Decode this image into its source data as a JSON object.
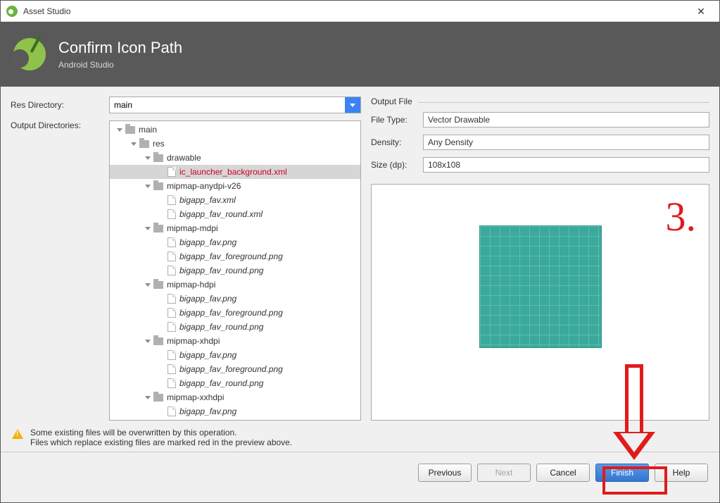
{
  "window": {
    "title": "Asset Studio",
    "close_tooltip": "Close"
  },
  "header": {
    "title": "Confirm Icon Path",
    "subtitle": "Android Studio"
  },
  "left": {
    "res_directory_label": "Res Directory:",
    "res_directory_value": "main",
    "output_directories_label": "Output Directories:"
  },
  "tree": [
    {
      "depth": 0,
      "type": "folder",
      "label": "main",
      "expand": true
    },
    {
      "depth": 1,
      "type": "folder",
      "label": "res",
      "expand": true
    },
    {
      "depth": 2,
      "type": "folder",
      "label": "drawable",
      "expand": true
    },
    {
      "depth": 3,
      "type": "file",
      "label": "ic_launcher_background.xml",
      "red": true,
      "selected": true
    },
    {
      "depth": 2,
      "type": "folder",
      "label": "mipmap-anydpi-v26",
      "expand": true
    },
    {
      "depth": 3,
      "type": "file",
      "label": "bigapp_fav.xml",
      "italic": true
    },
    {
      "depth": 3,
      "type": "file",
      "label": "bigapp_fav_round.xml",
      "italic": true
    },
    {
      "depth": 2,
      "type": "folder",
      "label": "mipmap-mdpi",
      "expand": true
    },
    {
      "depth": 3,
      "type": "file",
      "label": "bigapp_fav.png",
      "italic": true
    },
    {
      "depth": 3,
      "type": "file",
      "label": "bigapp_fav_foreground.png",
      "italic": true
    },
    {
      "depth": 3,
      "type": "file",
      "label": "bigapp_fav_round.png",
      "italic": true
    },
    {
      "depth": 2,
      "type": "folder",
      "label": "mipmap-hdpi",
      "expand": true
    },
    {
      "depth": 3,
      "type": "file",
      "label": "bigapp_fav.png",
      "italic": true
    },
    {
      "depth": 3,
      "type": "file",
      "label": "bigapp_fav_foreground.png",
      "italic": true
    },
    {
      "depth": 3,
      "type": "file",
      "label": "bigapp_fav_round.png",
      "italic": true
    },
    {
      "depth": 2,
      "type": "folder",
      "label": "mipmap-xhdpi",
      "expand": true
    },
    {
      "depth": 3,
      "type": "file",
      "label": "bigapp_fav.png",
      "italic": true
    },
    {
      "depth": 3,
      "type": "file",
      "label": "bigapp_fav_foreground.png",
      "italic": true
    },
    {
      "depth": 3,
      "type": "file",
      "label": "bigapp_fav_round.png",
      "italic": true
    },
    {
      "depth": 2,
      "type": "folder",
      "label": "mipmap-xxhdpi",
      "expand": true
    },
    {
      "depth": 3,
      "type": "file",
      "label": "bigapp_fav.png",
      "italic": true
    }
  ],
  "right": {
    "output_file_label": "Output File",
    "file_type_label": "File Type:",
    "file_type_value": "Vector Drawable",
    "density_label": "Density:",
    "density_value": "Any Density",
    "size_label": "Size (dp):",
    "size_value": "108x108"
  },
  "warning": {
    "line1": "Some existing files will be overwritten by this operation.",
    "line2": "Files which replace existing files are marked red in the preview above."
  },
  "buttons": {
    "previous": "Previous",
    "next": "Next",
    "cancel": "Cancel",
    "finish": "Finish",
    "help": "Help"
  },
  "annotation": {
    "step": "3."
  }
}
